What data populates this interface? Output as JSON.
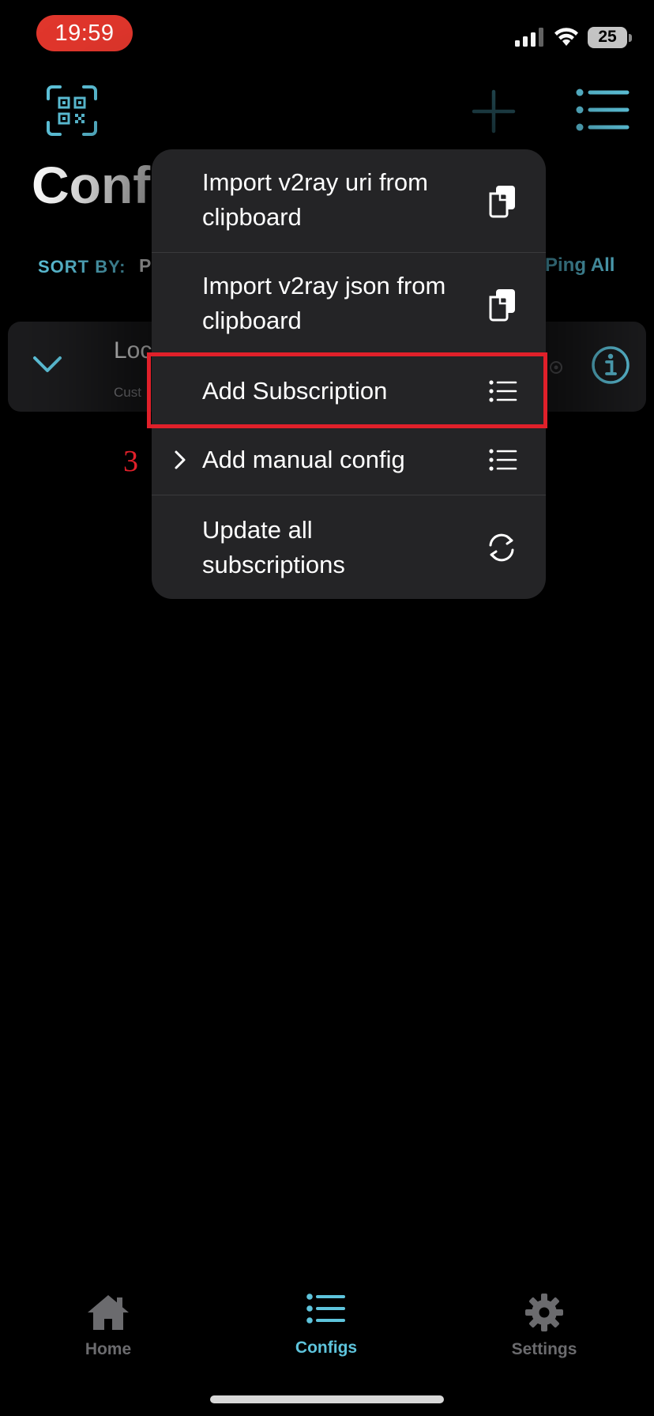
{
  "status_bar": {
    "time": "19:59",
    "battery": "25"
  },
  "header": {
    "title": "Conf",
    "sort_label": "SORT BY:",
    "sort_value": "P",
    "ping_all": "Ping All"
  },
  "config_card": {
    "title": "Loc",
    "subtitle": "Cust"
  },
  "context_menu": {
    "items": [
      {
        "label_line1": "Import v2ray uri from",
        "label_line2": "clipboard",
        "icon": "clipboard-icon"
      },
      {
        "label_line1": "Import v2ray json from",
        "label_line2": "clipboard",
        "icon": "clipboard-icon"
      },
      {
        "label": "Add Subscription",
        "icon": "list-icon"
      },
      {
        "label": "Add manual config",
        "icon": "list-icon",
        "has_submenu": true
      },
      {
        "label_line1": "Update all",
        "label_line2": "subscriptions",
        "icon": "refresh-icon"
      }
    ]
  },
  "annotation": {
    "step": "3",
    "color": "#e0202a"
  },
  "tab_bar": {
    "tabs": [
      {
        "label": "Home",
        "icon": "home-icon",
        "active": false
      },
      {
        "label": "Configs",
        "icon": "list-icon",
        "active": true
      },
      {
        "label": "Settings",
        "icon": "gear-icon",
        "active": false
      }
    ]
  },
  "colors": {
    "accent": "#5ec4dc",
    "background": "#000000",
    "menu_background": "#242426",
    "inactive_tab": "#6b6b6e"
  }
}
